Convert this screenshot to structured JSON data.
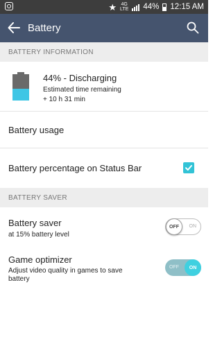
{
  "status_bar": {
    "network": "4G",
    "network_sub": "LTE",
    "battery_percent": "44%",
    "time": "12:15 AM"
  },
  "app_bar": {
    "title": "Battery"
  },
  "sections": {
    "battery_information": "BATTERY INFORMATION",
    "battery_saver": "BATTERY SAVER"
  },
  "battery_info": {
    "level": 0.44,
    "status": "44% - Discharging",
    "estimated_label": "Estimated time remaining",
    "estimated_value": "+ 10 h 31 min",
    "fill_color": "#3fc6e5"
  },
  "battery_usage": {
    "label": "Battery usage"
  },
  "percentage_status_bar": {
    "label": "Battery percentage on Status Bar",
    "checked": true
  },
  "battery_saver": {
    "title": "Battery saver",
    "subtitle": "at 15% battery level",
    "toggle_knob": "OFF",
    "toggle_other": "ON",
    "enabled": false
  },
  "game_optimizer": {
    "title": "Game optimizer",
    "subtitle_line1": "Adjust video quality in games to save",
    "subtitle_line2": "battery",
    "toggle_other": "OFF",
    "toggle_knob": "ON",
    "enabled": true
  },
  "colors": {
    "app_bar": "#45546e",
    "status_bar": "#3d3d3d",
    "accent": "#32c3d6"
  }
}
